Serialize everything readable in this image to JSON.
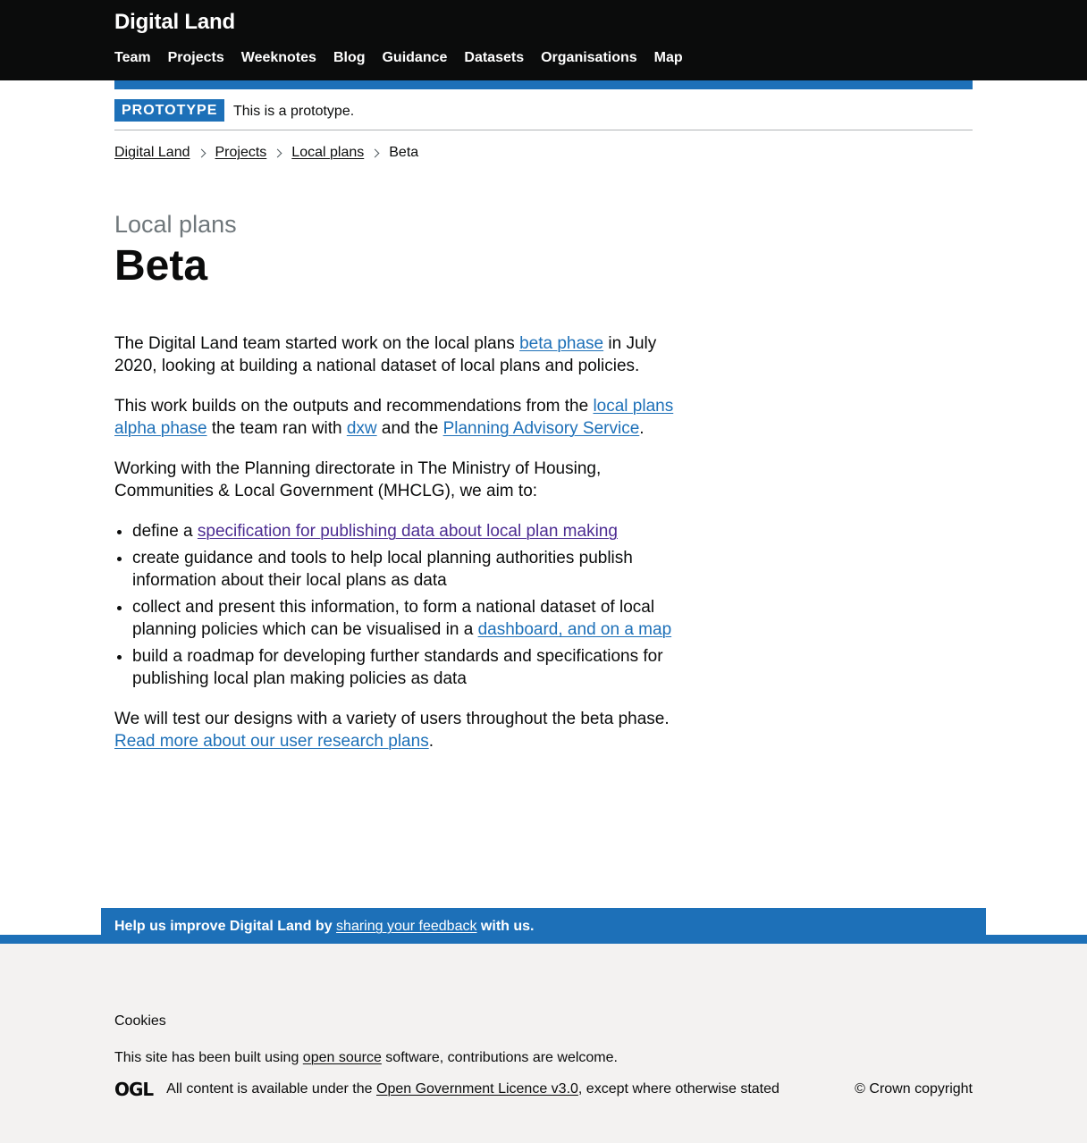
{
  "header": {
    "site_title": "Digital Land",
    "nav": [
      "Team",
      "Projects",
      "Weeknotes",
      "Blog",
      "Guidance",
      "Datasets",
      "Organisations",
      "Map"
    ]
  },
  "phase_banner": {
    "tag": "PROTOTYPE",
    "text": "This is a prototype."
  },
  "breadcrumbs": [
    "Digital Land",
    "Projects",
    "Local plans",
    "Beta"
  ],
  "page": {
    "caption": "Local plans",
    "title": "Beta"
  },
  "content": {
    "p1": {
      "before": "The Digital Land team started work on the local plans ",
      "link": "beta phase",
      "after": " in July 2020, looking at building a national dataset of local plans and policies."
    },
    "p2": {
      "before": "This work builds on the outputs and recommendations from the ",
      "link1": "local plans alpha phase",
      "mid1": " the team ran with ",
      "link2": "dxw",
      "mid2": " and the ",
      "link3": "Planning Advisory Service",
      "after": "."
    },
    "p3": "Working with the Planning directorate in The Ministry of Housing, Communities & Local Government (MHCLG), we aim to:",
    "list": {
      "item1_before": "define a ",
      "item1_link": "specification for publishing data about local plan making",
      "item2": "create guidance and tools to help local planning authorities publish information about their local plans as data",
      "item3_before": "collect and present this information, to form a national dataset of local planning policies which can be visualised in a ",
      "item3_link": "dashboard, and on a map",
      "item4": "build a roadmap for developing further standards and specifications for publishing local plan making policies as data"
    },
    "p4": {
      "before": "We will test our designs with a variety of users throughout the beta phase. ",
      "link": "Read more about our user research plans",
      "after": "."
    }
  },
  "feedback": {
    "before": "Help us improve Digital Land by ",
    "link": "sharing your feedback",
    "after": " with us."
  },
  "footer": {
    "cookies": "Cookies",
    "os_before": "This site has been built using ",
    "os_link": "open source",
    "os_after": " software, contributions are welcome.",
    "ogl_logo": "OGL",
    "licence_before": "All content is available under the ",
    "licence_link": "Open Government Licence v3.0",
    "licence_after": ", except where otherwise stated",
    "copyright": "© Crown copyright"
  },
  "colors": {
    "header_bg": "#0b0c0c",
    "accent_blue": "#1d70b8",
    "link": "#1d70b8",
    "visited_link": "#4c2c92",
    "footer_bg": "#f3f2f1"
  }
}
